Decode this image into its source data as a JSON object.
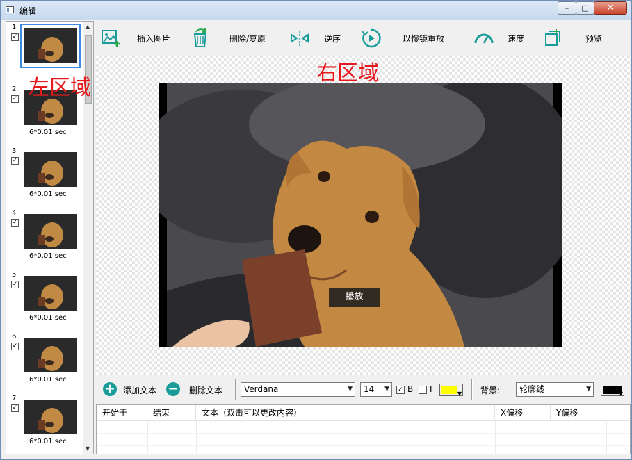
{
  "window": {
    "title": "编辑",
    "min_label": "–",
    "max_label": "□",
    "close_label": "✕"
  },
  "annotations": {
    "left": "左区域",
    "right": "右区域"
  },
  "frames": [
    {
      "num": "1",
      "checked": true,
      "delay": ""
    },
    {
      "num": "2",
      "checked": true,
      "delay": "6*0.01 sec"
    },
    {
      "num": "3",
      "checked": true,
      "delay": "6*0.01 sec"
    },
    {
      "num": "4",
      "checked": true,
      "delay": "6*0.01 sec"
    },
    {
      "num": "5",
      "checked": true,
      "delay": "6*0.01 sec"
    },
    {
      "num": "6",
      "checked": true,
      "delay": "6*0.01 sec"
    },
    {
      "num": "7",
      "checked": true,
      "delay": "6*0.01 sec"
    }
  ],
  "toolbar": {
    "insert_image": "插入图片",
    "delete_restore": "删除/复原",
    "reverse": "逆序",
    "slow_replay": "以慢镜重放",
    "speed": "速度",
    "preview": "预览"
  },
  "preview": {
    "play_label": "播放"
  },
  "text_toolbar": {
    "add_text": "添加文本",
    "delete_text": "删除文本",
    "font": "Verdana",
    "size": "14",
    "bold_label": "B",
    "bold_checked": true,
    "italic_label": "I",
    "italic_checked": false,
    "text_color": "#ffff00",
    "background_label": "背景:",
    "background_value": "轮廓线",
    "background_color": "#000000"
  },
  "table": {
    "headers": [
      "开始于",
      "结束",
      "文本（双击可以更改内容）",
      "X偏移",
      "Y偏移"
    ]
  },
  "colors": {
    "accent": "#1a9c9a",
    "annotation": "#e8191d",
    "selection": "#3c8be0"
  }
}
